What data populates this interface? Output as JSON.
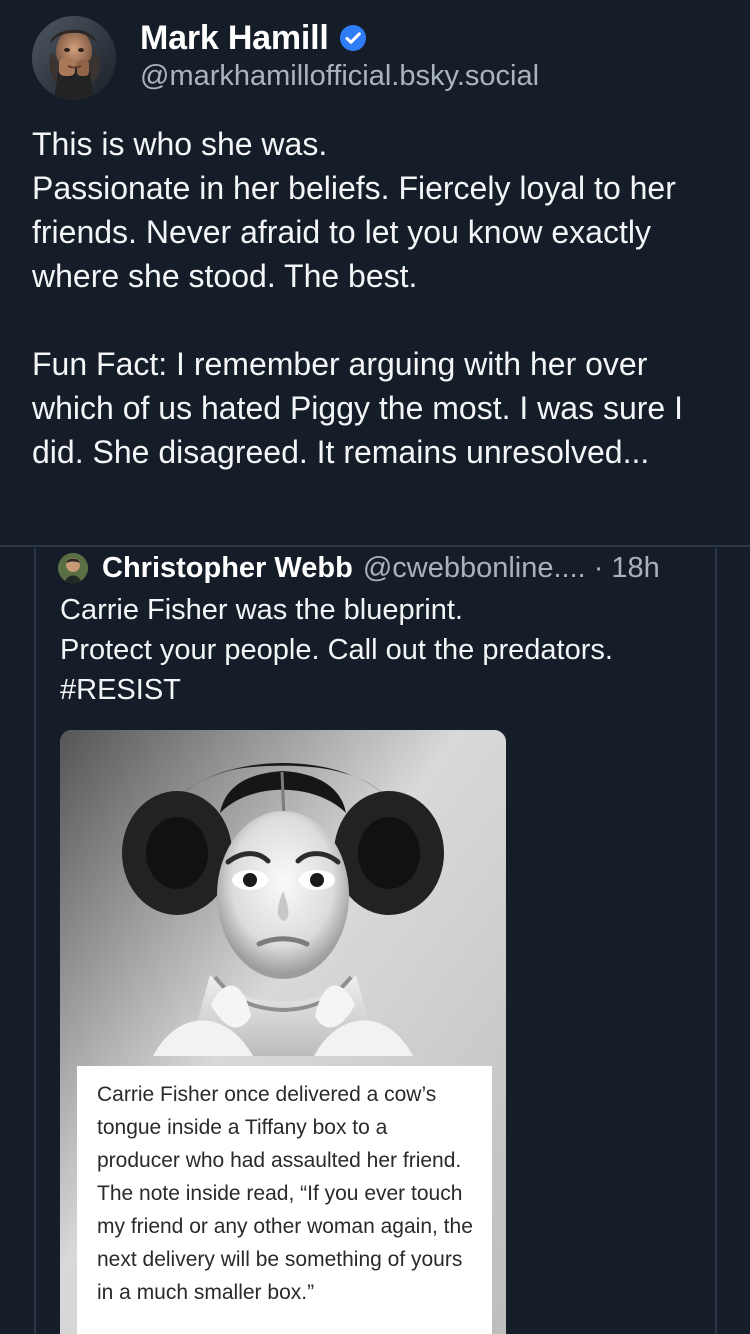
{
  "post": {
    "author": {
      "name": "Mark Hamill",
      "handle": "@markhamillofficial.bsky.social",
      "verified_color": "#2f7df6",
      "avatar_icon": "profile-photo-icon"
    },
    "body": {
      "line1": "This is who she was.",
      "line2": "Passionate in her beliefs. Fiercely loyal to her friends. Never afraid to let you know exactly where she stood. The best.",
      "line3": "Fun Fact: I remember arguing with her over which of us hated Piggy the most. I was sure I did. She disagreed. It remains unresolved..."
    }
  },
  "quoted_post": {
    "author": "Christopher Webb",
    "handle": "@cwebbonline....",
    "separator": "·",
    "time": "18h",
    "text": {
      "line1": "Carrie Fisher was the blueprint.",
      "line2": "Protect your people. Call out the predators.",
      "line3": "#RESIST"
    },
    "image": {
      "caption": "Carrie Fisher once delivered a cow’s tongue inside a Tiffany box to a producer who had assaulted her friend. The note inside read, “If you ever touch my friend or any other woman again, the next delivery will be something of yours in a much smaller box.”"
    }
  },
  "theme": {
    "background": "#151d28",
    "text": "#f3f5f7",
    "muted": "#a8b2bf",
    "divider": "#2a3646"
  }
}
